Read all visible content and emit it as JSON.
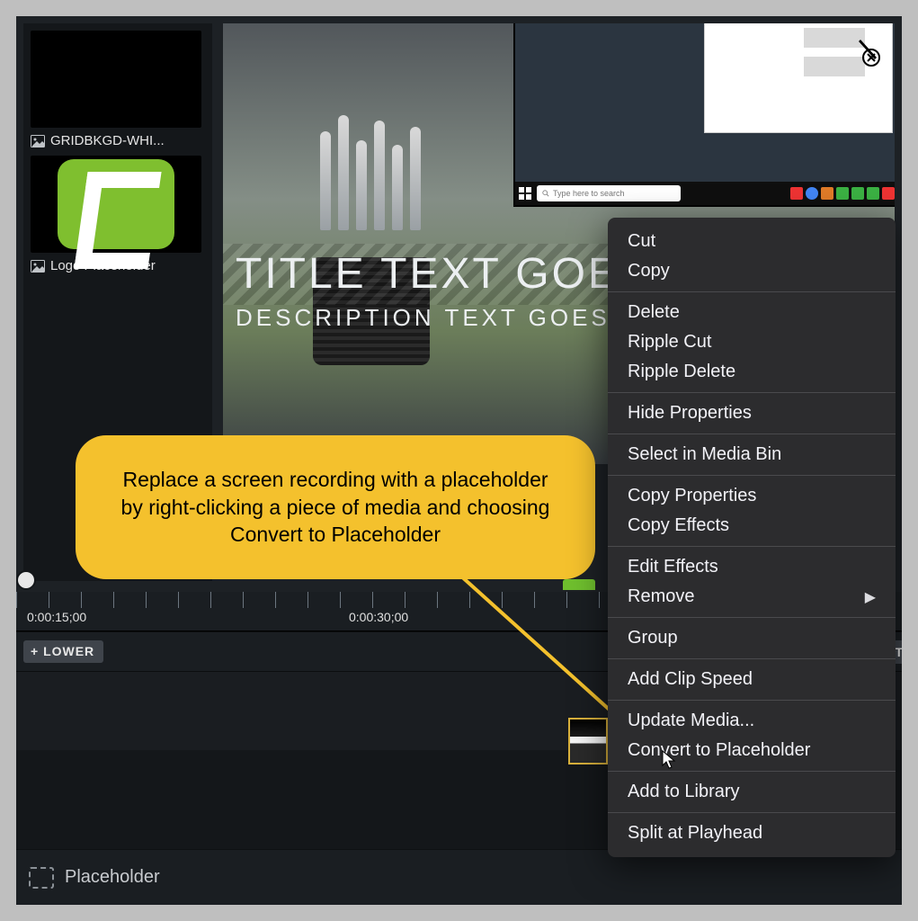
{
  "media_bin": {
    "items": [
      {
        "label": "GRIDBKGD-WHI..."
      },
      {
        "label": "Logo Placeholder"
      }
    ]
  },
  "canvas": {
    "title": "TITLE TEXT GOE",
    "description": "DESCRIPTION TEXT GOES HE",
    "taskbar_search_placeholder": "Type here to search"
  },
  "timeline": {
    "time_marks": [
      "0:00:15;00",
      "0:00:30;00"
    ],
    "track_button": "+  LOWER",
    "right_stub": "UT",
    "placeholder_label": "Placeholder"
  },
  "callout": {
    "text": "Replace a screen recording with a placeholder by right-clicking a piece of media and choosing Convert to Placeholder"
  },
  "context_menu": {
    "sections": [
      [
        "Cut",
        "Copy"
      ],
      [
        "Delete",
        "Ripple Cut",
        "Ripple Delete"
      ],
      [
        "Hide Properties"
      ],
      [
        "Select in Media Bin"
      ],
      [
        "Copy Properties",
        "Copy Effects"
      ],
      [
        "Edit Effects",
        "Remove"
      ],
      [
        "Group"
      ],
      [
        "Add Clip Speed"
      ],
      [
        "Update Media...",
        "Convert to Placeholder"
      ],
      [
        "Add to Library"
      ],
      [
        "Split at Playhead"
      ]
    ],
    "submenu_items": [
      "Remove"
    ]
  }
}
